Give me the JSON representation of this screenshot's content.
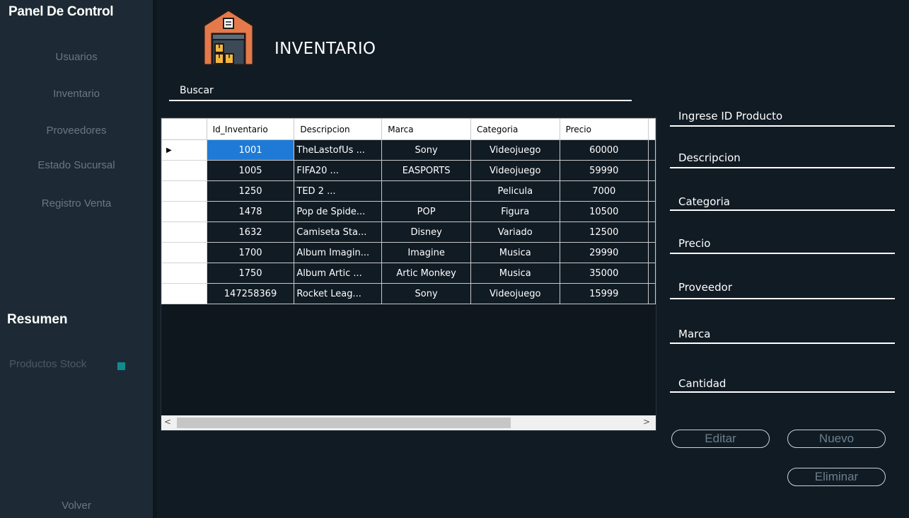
{
  "sidebar": {
    "title": "Panel De Control",
    "items": [
      {
        "label": "Usuarios"
      },
      {
        "label": "Inventario"
      },
      {
        "label": "Proveedores"
      },
      {
        "label": "Estado Sucursal"
      },
      {
        "label": "Registro Venta"
      }
    ],
    "summary_title": "Resumen",
    "stock_label": "Productos Stock",
    "stock_indicator_color": "#0f8c8c",
    "back_label": "Volver"
  },
  "header": {
    "title": "INVENTARIO",
    "icon": "warehouse-icon"
  },
  "search": {
    "label": "Buscar",
    "value": ""
  },
  "table": {
    "columns": [
      "Id_Inventario",
      "Descripcion",
      "Marca",
      "Categoria",
      "Precio"
    ],
    "rows": [
      {
        "id": "1001",
        "descripcion": "TheLastofUs   ...",
        "marca": "Sony",
        "categoria": "Videojuego",
        "precio": "60000",
        "selected": true
      },
      {
        "id": "1005",
        "descripcion": "FIFA20           ...",
        "marca": "EASPORTS",
        "categoria": "Videojuego",
        "precio": "59990"
      },
      {
        "id": "1250",
        "descripcion": "TED 2             ...",
        "marca": "",
        "categoria": "Pelicula",
        "precio": "7000"
      },
      {
        "id": "1478",
        "descripcion": "Pop de Spide...",
        "marca": "POP",
        "categoria": "Figura",
        "precio": "10500"
      },
      {
        "id": "1632",
        "descripcion": "Camiseta Sta...",
        "marca": "Disney",
        "categoria": "Variado",
        "precio": "12500"
      },
      {
        "id": "1700",
        "descripcion": "Album Imagin...",
        "marca": "Imagine",
        "categoria": "Musica",
        "precio": "29990"
      },
      {
        "id": "1750",
        "descripcion": " Album Artic ...",
        "marca": "Artic Monkey",
        "categoria": "Musica",
        "precio": "35000"
      },
      {
        "id": "147258369",
        "descripcion": "Rocket Leag...",
        "marca": "Sony",
        "categoria": "Videojuego",
        "precio": "15999"
      }
    ],
    "selection_color": "#1f7ad6"
  },
  "form": {
    "fields": [
      {
        "label": "Ingrese ID Producto",
        "value": ""
      },
      {
        "label": "Descripcion",
        "value": ""
      },
      {
        "label": "Categoria",
        "value": ""
      },
      {
        "label": "Precio",
        "value": ""
      },
      {
        "label": "Proveedor",
        "value": ""
      },
      {
        "label": "Marca",
        "value": ""
      },
      {
        "label": "Cantidad",
        "value": ""
      }
    ],
    "buttons": {
      "edit": "Editar",
      "new": "Nuevo",
      "delete": "Eliminar"
    }
  }
}
